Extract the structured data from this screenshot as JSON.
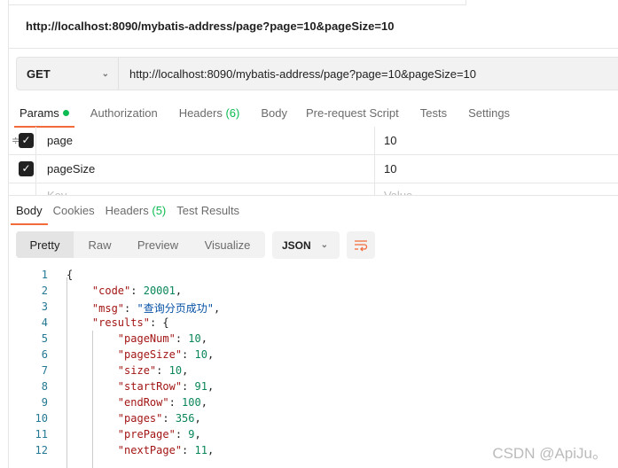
{
  "title": "http://localhost:8090/mybatis-address/page?page=10&pageSize=10",
  "request": {
    "method": "GET",
    "url": "http://localhost:8090/mybatis-address/page?page=10&pageSize=10"
  },
  "request_tabs": [
    {
      "label": "Params"
    },
    {
      "label": "Authorization"
    },
    {
      "label": "Headers ",
      "count": "(6)"
    },
    {
      "label": "Body"
    },
    {
      "label": "Pre-request Script"
    },
    {
      "label": "Tests"
    },
    {
      "label": "Settings"
    }
  ],
  "params": [
    {
      "key": "page",
      "value": "10",
      "checked": true
    },
    {
      "key": "pageSize",
      "value": "10",
      "checked": true
    }
  ],
  "params_placeholder": {
    "key": "Key",
    "value": "Value"
  },
  "response_tabs": [
    {
      "label": "Body"
    },
    {
      "label": "Cookies"
    },
    {
      "label": "Headers ",
      "count": "(5)"
    },
    {
      "label": "Test Results"
    }
  ],
  "view_modes": [
    "Pretty",
    "Raw",
    "Preview",
    "Visualize"
  ],
  "format": "JSON",
  "code_lines": [
    {
      "n": "1",
      "parts": [
        [
          "",
          "{"
        ]
      ]
    },
    {
      "n": "2",
      "parts": [
        [
          "",
          "    "
        ],
        [
          "k",
          "\"code\""
        ],
        [
          "",
          ": "
        ],
        [
          "n",
          "20001"
        ],
        [
          "",
          ","
        ]
      ]
    },
    {
      "n": "3",
      "parts": [
        [
          "",
          "    "
        ],
        [
          "k",
          "\"msg\""
        ],
        [
          "",
          ": "
        ],
        [
          "s",
          "\"查询分页成功\""
        ],
        [
          "",
          ","
        ]
      ]
    },
    {
      "n": "4",
      "parts": [
        [
          "",
          "    "
        ],
        [
          "k",
          "\"results\""
        ],
        [
          "",
          ": {"
        ]
      ]
    },
    {
      "n": "5",
      "parts": [
        [
          "",
          "        "
        ],
        [
          "k",
          "\"pageNum\""
        ],
        [
          "",
          ": "
        ],
        [
          "n",
          "10"
        ],
        [
          "",
          ","
        ]
      ]
    },
    {
      "n": "6",
      "parts": [
        [
          "",
          "        "
        ],
        [
          "k",
          "\"pageSize\""
        ],
        [
          "",
          ": "
        ],
        [
          "n",
          "10"
        ],
        [
          "",
          ","
        ]
      ]
    },
    {
      "n": "7",
      "parts": [
        [
          "",
          "        "
        ],
        [
          "k",
          "\"size\""
        ],
        [
          "",
          ": "
        ],
        [
          "n",
          "10"
        ],
        [
          "",
          ","
        ]
      ]
    },
    {
      "n": "8",
      "parts": [
        [
          "",
          "        "
        ],
        [
          "k",
          "\"startRow\""
        ],
        [
          "",
          ": "
        ],
        [
          "n",
          "91"
        ],
        [
          "",
          ","
        ]
      ]
    },
    {
      "n": "9",
      "parts": [
        [
          "",
          "        "
        ],
        [
          "k",
          "\"endRow\""
        ],
        [
          "",
          ": "
        ],
        [
          "n",
          "100"
        ],
        [
          "",
          ","
        ]
      ]
    },
    {
      "n": "10",
      "parts": [
        [
          "",
          "        "
        ],
        [
          "k",
          "\"pages\""
        ],
        [
          "",
          ": "
        ],
        [
          "n",
          "356"
        ],
        [
          "",
          ","
        ]
      ]
    },
    {
      "n": "11",
      "parts": [
        [
          "",
          "        "
        ],
        [
          "k",
          "\"prePage\""
        ],
        [
          "",
          ": "
        ],
        [
          "n",
          "9"
        ],
        [
          "",
          ","
        ]
      ]
    },
    {
      "n": "12",
      "parts": [
        [
          "",
          "        "
        ],
        [
          "k",
          "\"nextPage\""
        ],
        [
          "",
          ": "
        ],
        [
          "n",
          "11"
        ],
        [
          "",
          ","
        ]
      ]
    }
  ],
  "watermark": "CSDN @ApiJu。",
  "colors": {
    "accent": "#f26b3a",
    "green": "#0cbb52",
    "key": "#a31515",
    "number": "#098658",
    "string": "#0451a5"
  }
}
